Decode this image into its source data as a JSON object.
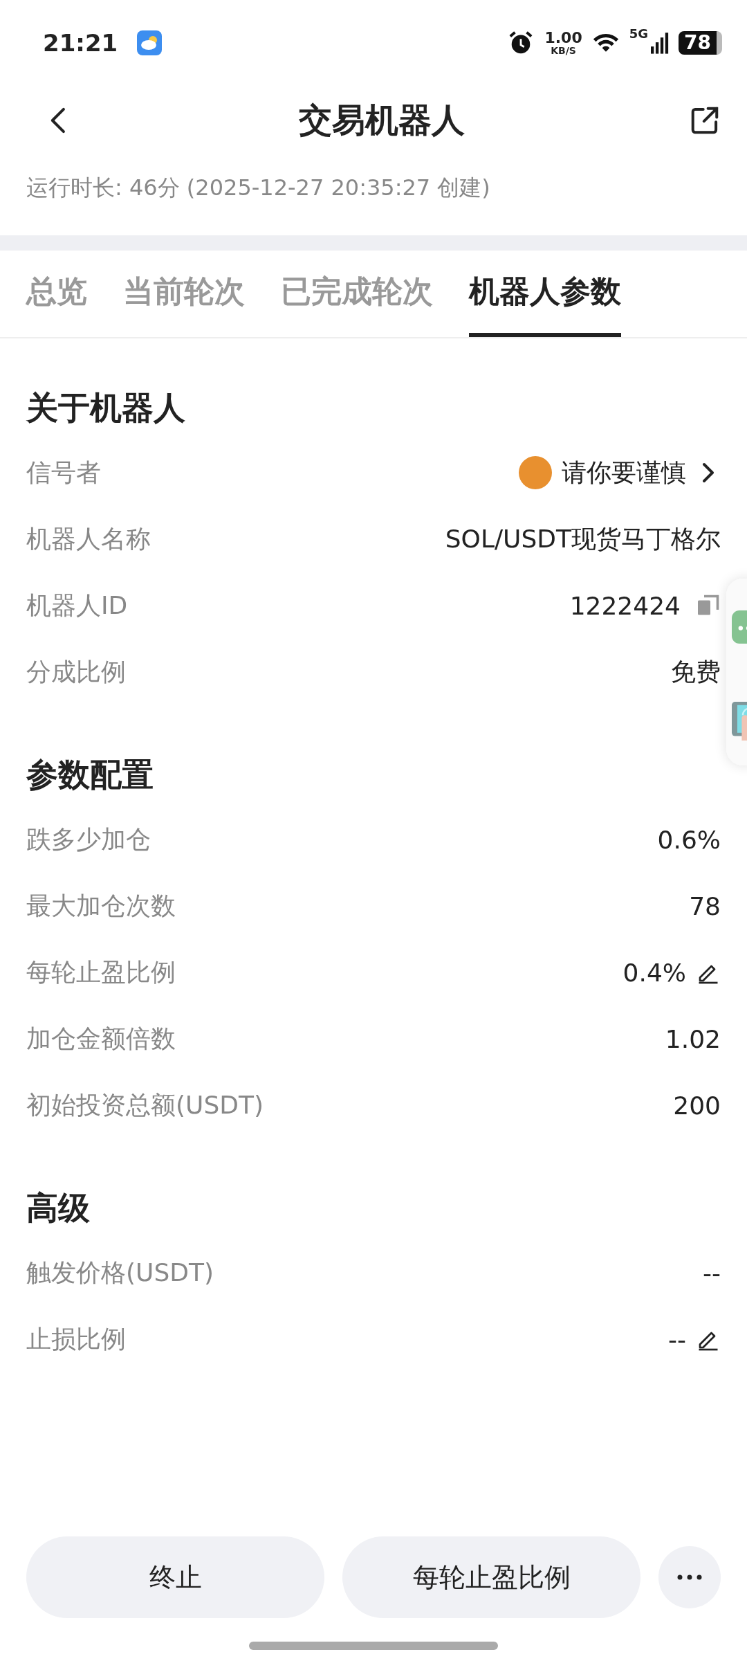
{
  "status_bar": {
    "time": "21:21",
    "net_speed": "1.00",
    "net_unit": "KB/S",
    "network": "5G",
    "battery": "78"
  },
  "header": {
    "title": "交易机器人"
  },
  "runtime": "运行时长: 46分 (2025-12-27 20:35:27 创建)",
  "tabs": [
    {
      "label": "总览",
      "selected": false
    },
    {
      "label": "当前轮次",
      "selected": false
    },
    {
      "label": "已完成轮次",
      "selected": false
    },
    {
      "label": "机器人参数",
      "selected": true
    }
  ],
  "sections": [
    {
      "title": "关于机器人",
      "rows": [
        {
          "label": "信号者",
          "value": "请你要谨慎",
          "kind": "link"
        },
        {
          "label": "机器人名称",
          "value": "SOL/USDT现货马丁格尔",
          "kind": "text"
        },
        {
          "label": "机器人ID",
          "value": "1222424",
          "kind": "copy"
        },
        {
          "label": "分成比例",
          "value": "免费",
          "kind": "text"
        }
      ]
    },
    {
      "title": "参数配置",
      "rows": [
        {
          "label": "跌多少加仓",
          "value": "0.6%",
          "kind": "text"
        },
        {
          "label": "最大加仓次数",
          "value": "78",
          "kind": "text"
        },
        {
          "label": "每轮止盈比例",
          "value": "0.4%",
          "kind": "edit"
        },
        {
          "label": "加仓金额倍数",
          "value": "1.02",
          "kind": "text"
        },
        {
          "label": "初始投资总额(USDT)",
          "value": "200",
          "kind": "text"
        }
      ]
    },
    {
      "title": "高级",
      "rows": [
        {
          "label": "触发价格(USDT)",
          "value": "--",
          "kind": "text"
        },
        {
          "label": "止损比例",
          "value": "--",
          "kind": "edit"
        }
      ]
    }
  ],
  "buttons": [
    {
      "label": "终止"
    },
    {
      "label": "每轮止盈比例"
    }
  ]
}
